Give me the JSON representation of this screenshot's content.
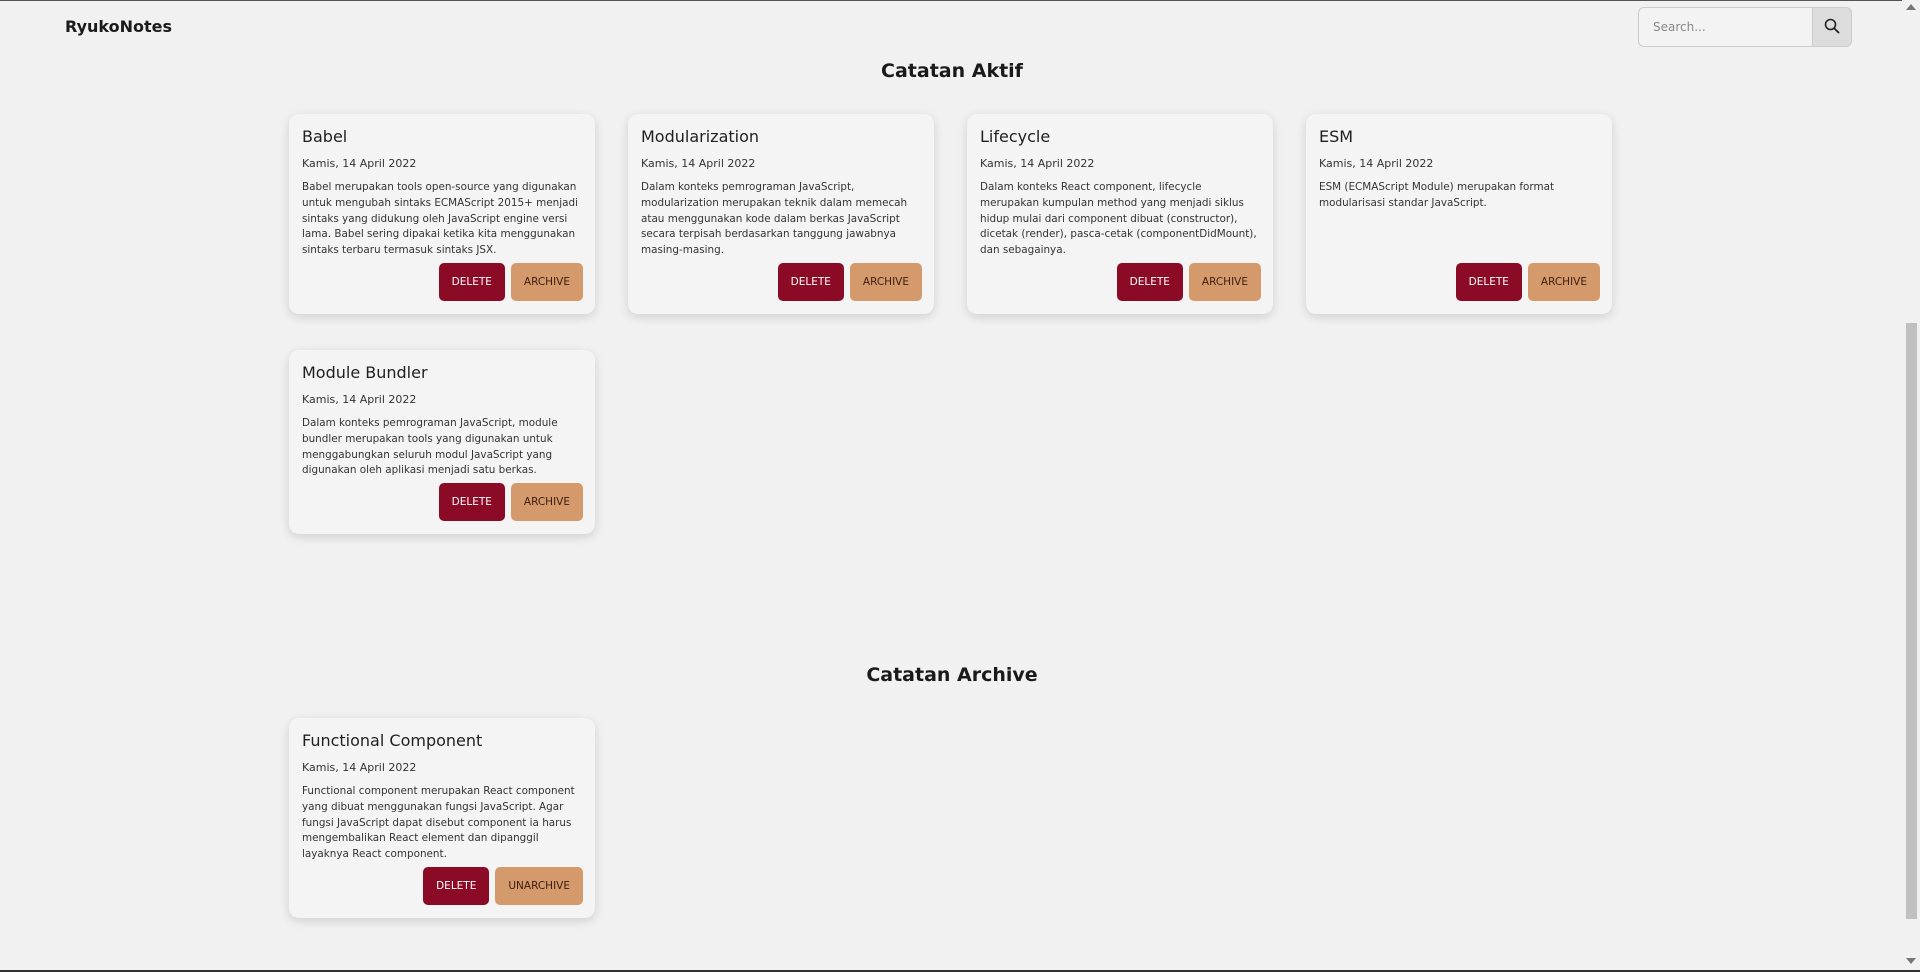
{
  "app": {
    "brand": "RyukoNotes"
  },
  "search": {
    "placeholder": "Search...",
    "icon": "search-icon"
  },
  "sections": {
    "active_title": "Catatan Aktif",
    "archive_title": "Catatan Archive"
  },
  "active_notes": [
    {
      "title": "Babel",
      "date": "Kamis, 14 April 2022",
      "body": "Babel merupakan tools open-source yang digunakan untuk mengubah sintaks ECMAScript 2015+ menjadi sintaks yang didukung oleh JavaScript engine versi lama. Babel sering dipakai ketika kita menggunakan sintaks terbaru termasuk sintaks JSX.",
      "delete_label": "DELETE",
      "archive_label": "ARCHIVE"
    },
    {
      "title": "Modularization",
      "date": "Kamis, 14 April 2022",
      "body": "Dalam konteks pemrograman JavaScript, modularization merupakan teknik dalam memecah atau menggunakan kode dalam berkas JavaScript secara terpisah berdasarkan tanggung jawabnya masing-masing.",
      "delete_label": "DELETE",
      "archive_label": "ARCHIVE"
    },
    {
      "title": "Lifecycle",
      "date": "Kamis, 14 April 2022",
      "body": "Dalam konteks React component, lifecycle merupakan kumpulan method yang menjadi siklus hidup mulai dari component dibuat (constructor), dicetak (render), pasca-cetak (componentDidMount), dan sebagainya.",
      "delete_label": "DELETE",
      "archive_label": "ARCHIVE"
    },
    {
      "title": "ESM",
      "date": "Kamis, 14 April 2022",
      "body": "ESM (ECMAScript Module) merupakan format modularisasi standar JavaScript.",
      "delete_label": "DELETE",
      "archive_label": "ARCHIVE"
    },
    {
      "title": "Module Bundler",
      "date": "Kamis, 14 April 2022",
      "body": "Dalam konteks pemrograman JavaScript, module bundler merupakan tools yang digunakan untuk menggabungkan seluruh modul JavaScript yang digunakan oleh aplikasi menjadi satu berkas.",
      "delete_label": "DELETE",
      "archive_label": "ARCHIVE"
    }
  ],
  "archived_notes": [
    {
      "title": "Functional Component",
      "date": "Kamis, 14 April 2022",
      "body": "Functional component merupakan React component yang dibuat menggunakan fungsi JavaScript. Agar fungsi JavaScript dapat disebut component ia harus mengembalikan React element dan dipanggil layaknya React component.",
      "delete_label": "DELETE",
      "unarchive_label": "UNARCHIVE"
    }
  ],
  "colors": {
    "delete": "#8b0a26",
    "archive": "#d59a6c",
    "background": "#f1f1f1"
  }
}
